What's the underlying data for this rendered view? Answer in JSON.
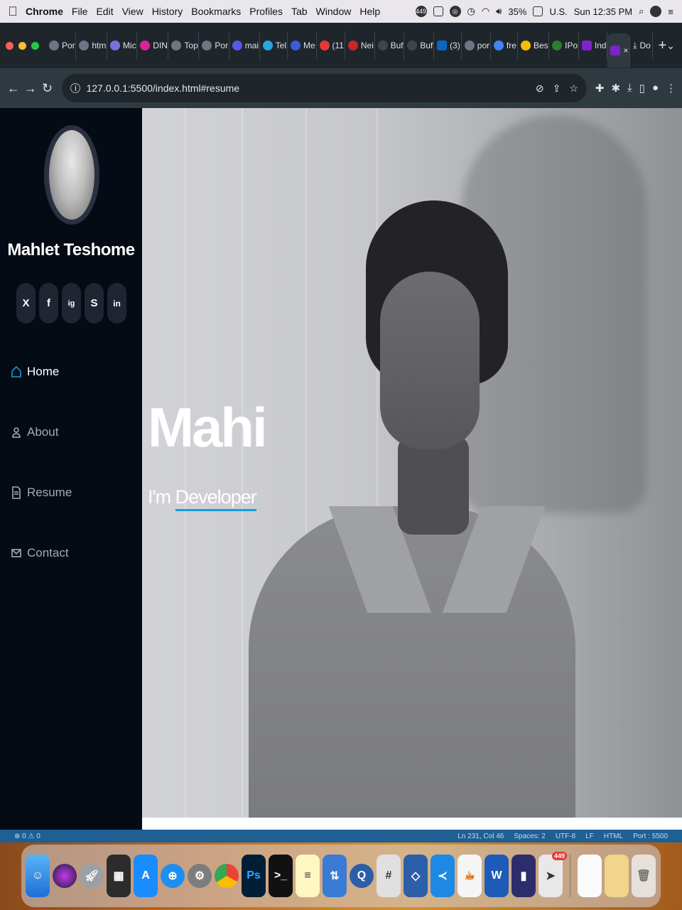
{
  "menubar": {
    "app_name": "Chrome",
    "menus": [
      "File",
      "Edit",
      "View",
      "History",
      "Bookmarks",
      "Profiles",
      "Tab",
      "Window",
      "Help"
    ],
    "status": {
      "badge": "449",
      "battery": "35%",
      "input": "U.S.",
      "clock": "Sun 12:35 PM"
    }
  },
  "browser": {
    "tabs": [
      {
        "label": "Por"
      },
      {
        "label": "htm"
      },
      {
        "label": "Mic"
      },
      {
        "label": "DIN"
      },
      {
        "label": "Top"
      },
      {
        "label": "Por"
      },
      {
        "label": "mai"
      },
      {
        "label": "Tel"
      },
      {
        "label": "Me"
      },
      {
        "label": "(11"
      },
      {
        "label": "Nei"
      },
      {
        "label": "Buf"
      },
      {
        "label": "Buf"
      },
      {
        "label": "(3)"
      },
      {
        "label": "por"
      },
      {
        "label": "fre"
      },
      {
        "label": "Bes"
      },
      {
        "label": "IPo"
      },
      {
        "label": "Ind"
      }
    ],
    "active_tab_close": "×",
    "last_tab": "Do",
    "new_tab": "+",
    "url": "127.0.0.1:5500/index.html#resume"
  },
  "sidebar": {
    "name": "Mahlet Teshome",
    "socials": [
      "X",
      "f",
      "ig",
      "S",
      "in"
    ],
    "nav": [
      {
        "label": "Home",
        "icon": "house-icon",
        "active": true
      },
      {
        "label": "About",
        "icon": "person-icon",
        "active": false
      },
      {
        "label": "Resume",
        "icon": "document-icon",
        "active": false
      },
      {
        "label": "Contact",
        "icon": "envelope-icon",
        "active": false
      }
    ]
  },
  "hero": {
    "title": "Mahi",
    "prefix": "I'm ",
    "typed": "Developer"
  },
  "editor_status": {
    "left": "⊗ 0 ⚠ 0",
    "right": [
      "Ln 231, Col 46",
      "Spaces: 2",
      "UTF-8",
      "LF",
      "HTML",
      "Port : 5500"
    ]
  },
  "dock": {
    "badge": "449",
    "apps": [
      "finder-icon",
      "siri-icon",
      "launchpad-icon",
      "photo-booth-icon",
      "app-store-icon",
      "safari-icon",
      "system-preferences-icon",
      "chrome-icon",
      "photoshop-icon",
      "terminal-icon",
      "notes-icon",
      "migration-assistant-icon",
      "quicktime-icon",
      "calculator-icon",
      "virtualbox-icon",
      "vscode-icon",
      "java-icon",
      "word-icon",
      "framer-icon",
      "telegram-icon",
      "document-icon",
      "archive-icon",
      "trash-icon"
    ]
  },
  "colors": {
    "accent": "#149ddd",
    "sidebar_bg": "#040b14",
    "social_bg": "#212431"
  }
}
